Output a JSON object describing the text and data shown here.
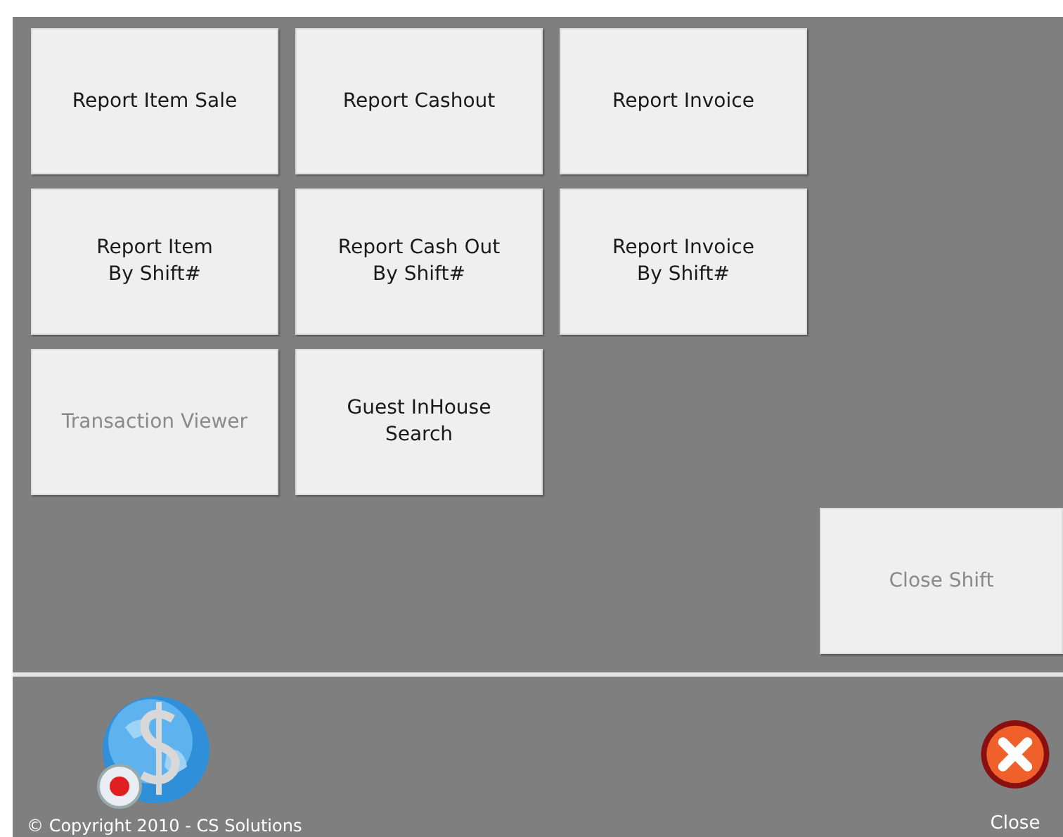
{
  "buttons": [
    {
      "label": "Report Item Sale",
      "disabled": false
    },
    {
      "label": "Report Cashout",
      "disabled": false
    },
    {
      "label": "Report Invoice",
      "disabled": false
    },
    {
      "label": "Report Item\nBy Shift#",
      "disabled": false
    },
    {
      "label": "Report Cash Out\nBy Shift#",
      "disabled": false
    },
    {
      "label": "Report Invoice\nBy Shift#",
      "disabled": false
    },
    {
      "label": "Transaction Viewer",
      "disabled": true
    },
    {
      "label": "Guest InHouse Search",
      "disabled": false
    }
  ],
  "close_shift_button": {
    "label": "Close Shift",
    "disabled": true
  },
  "footer": {
    "copyright": "© Copyright 2010 - CS Solutions",
    "close_label": "Close"
  }
}
